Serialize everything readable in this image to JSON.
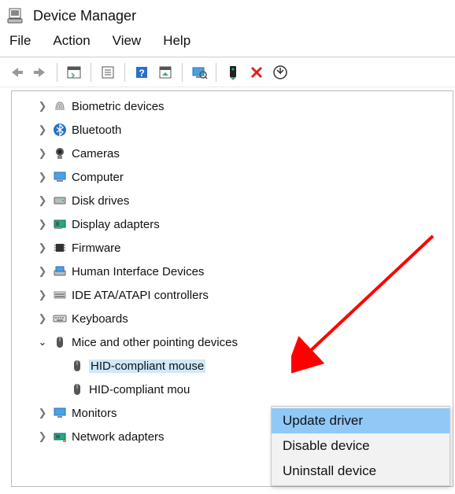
{
  "title": "Device Manager",
  "menu": {
    "file": "File",
    "action": "Action",
    "view": "View",
    "help": "Help"
  },
  "tree": {
    "biometric": "Biometric devices",
    "bluetooth": "Bluetooth",
    "cameras": "Cameras",
    "computer": "Computer",
    "disks": "Disk drives",
    "display": "Display adapters",
    "firmware": "Firmware",
    "hid": "Human Interface Devices",
    "ide": "IDE ATA/ATAPI controllers",
    "keyboards": "Keyboards",
    "mice": "Mice and other pointing devices",
    "mouse1": "HID-compliant mouse",
    "mouse2": "HID-compliant mou",
    "monitors": "Monitors",
    "network": "Network adapters"
  },
  "context": {
    "update": "Update driver",
    "disable": "Disable device",
    "uninstall": "Uninstall device"
  }
}
